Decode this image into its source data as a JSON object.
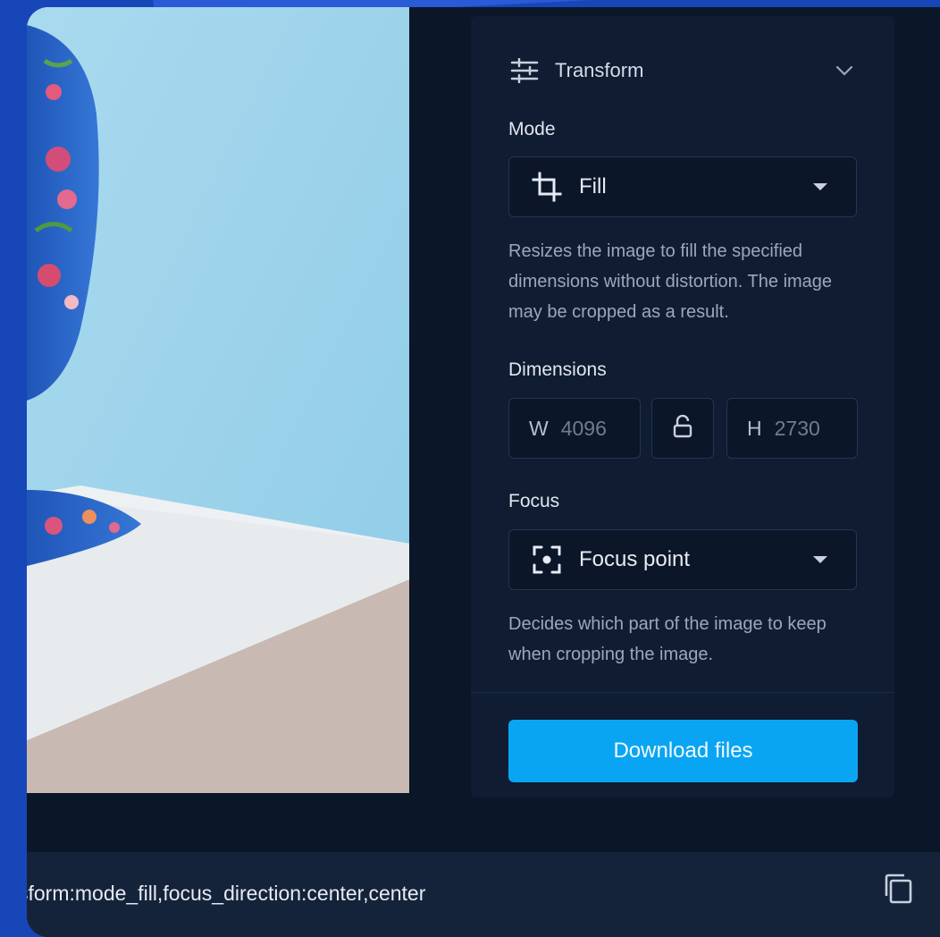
{
  "transform": {
    "section_title": "Transform",
    "section_icon": "sliders-icon",
    "mode": {
      "label": "Mode",
      "value": "Fill",
      "icon": "crop-icon",
      "description": "Resizes the image to fill the specified dimensions without distortion. The image may be cropped as a result."
    },
    "dimensions": {
      "label": "Dimensions",
      "width_prefix": "W",
      "width_value": "4096",
      "height_prefix": "H",
      "height_value": "2730",
      "lock_icon": "lock-open-icon"
    },
    "focus": {
      "label": "Focus",
      "value": "Focus point",
      "icon": "focus-point-icon",
      "description": "Decides which part of the image to keep when cropping the image."
    },
    "download_label": "Download files"
  },
  "url_bar": {
    "text": "sform:mode_fill,focus_direction:center,center",
    "copy_icon": "copy-icon"
  },
  "colors": {
    "accent": "#0aa5f2",
    "panel": "#0f1c31",
    "background": "#0b1628",
    "outer": "#1746b8"
  }
}
